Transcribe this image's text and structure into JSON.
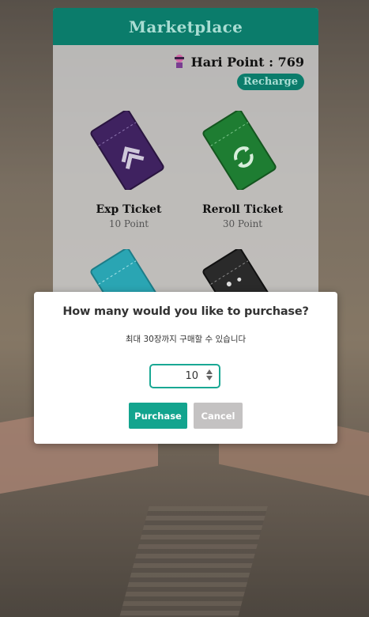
{
  "marketplace": {
    "title": "Marketplace",
    "points_label": "Hari Point : 769",
    "recharge_label": "Recharge",
    "tickets": [
      {
        "name": "Exp Ticket",
        "price": "10 Point",
        "color": "#3f2260",
        "tag": "EXP"
      },
      {
        "name": "Reroll Ticket",
        "price": "30 Point",
        "color": "#1e7d32",
        "tag": "REROLL"
      },
      {
        "name": "",
        "price": "",
        "color": "#2aa5b3",
        "tag": ""
      },
      {
        "name": "",
        "price": "",
        "color": "#2a2a2a",
        "tag": ""
      }
    ]
  },
  "dialog": {
    "title": "How many would you like to purchase?",
    "subtitle": "최대 30장까지 구매할 수 있습니다",
    "quantity": "10",
    "purchase_label": "Purchase",
    "cancel_label": "Cancel"
  },
  "colors": {
    "brand": "#0b7c6b",
    "purchase": "#13a48e",
    "cancel": "#c4c2c2"
  }
}
